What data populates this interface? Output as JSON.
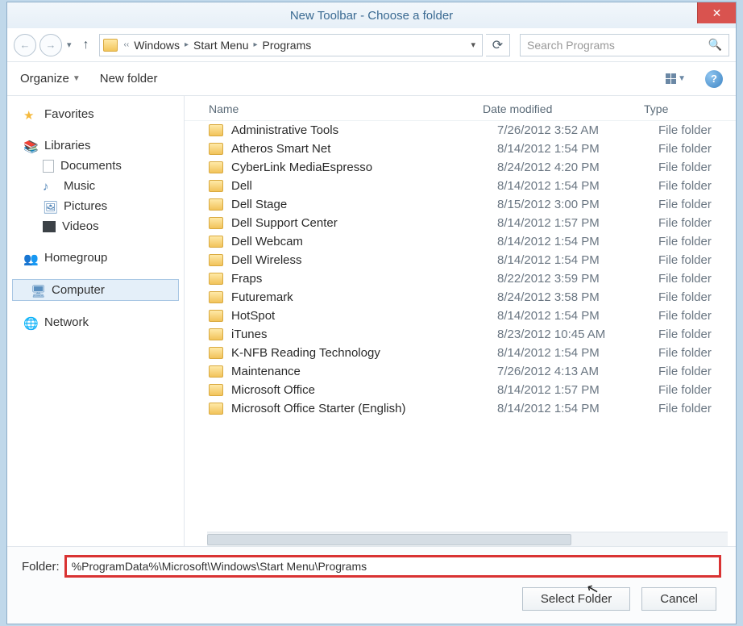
{
  "window": {
    "title": "New Toolbar - Choose a folder"
  },
  "breadcrumb": {
    "seg1": "Windows",
    "seg2": "Start Menu",
    "seg3": "Programs"
  },
  "search": {
    "placeholder": "Search Programs"
  },
  "toolbar": {
    "organize": "Organize",
    "newfolder": "New folder"
  },
  "sidebar": {
    "favorites": "Favorites",
    "libraries": "Libraries",
    "documents": "Documents",
    "music": "Music",
    "pictures": "Pictures",
    "videos": "Videos",
    "homegroup": "Homegroup",
    "computer": "Computer",
    "network": "Network"
  },
  "columns": {
    "name": "Name",
    "date": "Date modified",
    "type": "Type"
  },
  "type_label": "File folder",
  "items": [
    {
      "name": "Administrative Tools",
      "date": "7/26/2012 3:52 AM"
    },
    {
      "name": "Atheros Smart Net",
      "date": "8/14/2012 1:54 PM"
    },
    {
      "name": "CyberLink MediaEspresso",
      "date": "8/24/2012 4:20 PM"
    },
    {
      "name": "Dell",
      "date": "8/14/2012 1:54 PM"
    },
    {
      "name": "Dell Stage",
      "date": "8/15/2012 3:00 PM"
    },
    {
      "name": "Dell Support Center",
      "date": "8/14/2012 1:57 PM"
    },
    {
      "name": "Dell Webcam",
      "date": "8/14/2012 1:54 PM"
    },
    {
      "name": "Dell Wireless",
      "date": "8/14/2012 1:54 PM"
    },
    {
      "name": "Fraps",
      "date": "8/22/2012 3:59 PM"
    },
    {
      "name": "Futuremark",
      "date": "8/24/2012 3:58 PM"
    },
    {
      "name": "HotSpot",
      "date": "8/14/2012 1:54 PM"
    },
    {
      "name": "iTunes",
      "date": "8/23/2012 10:45 AM"
    },
    {
      "name": "K-NFB Reading Technology",
      "date": "8/14/2012 1:54 PM"
    },
    {
      "name": "Maintenance",
      "date": "7/26/2012 4:13 AM"
    },
    {
      "name": "Microsoft Office",
      "date": "8/14/2012 1:57 PM"
    },
    {
      "name": "Microsoft Office Starter (English)",
      "date": "8/14/2012 1:54 PM"
    }
  ],
  "footer": {
    "label": "Folder:",
    "value": "%ProgramData%\\Microsoft\\Windows\\Start Menu\\Programs",
    "select": "Select Folder",
    "cancel": "Cancel"
  }
}
